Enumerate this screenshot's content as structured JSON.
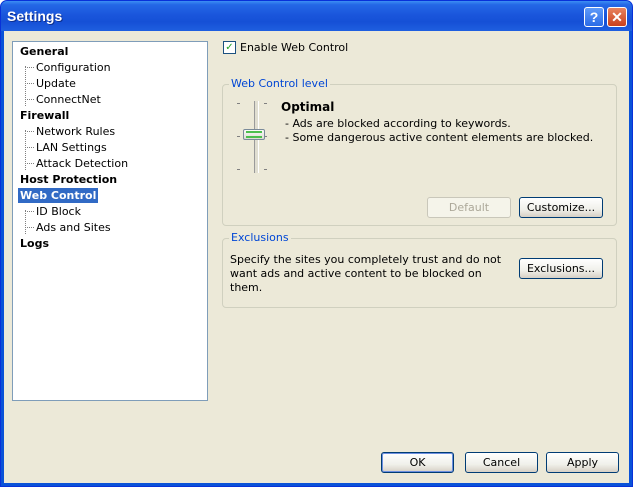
{
  "window": {
    "title": "Settings",
    "help_glyph": "?",
    "close_glyph": "✕"
  },
  "tree": {
    "general": {
      "label": "General",
      "children": [
        "Configuration",
        "Update",
        "ConnectNet"
      ]
    },
    "firewall": {
      "label": "Firewall",
      "children": [
        "Network Rules",
        "LAN Settings",
        "Attack Detection"
      ]
    },
    "host_protection": {
      "label": "Host Protection"
    },
    "web_control": {
      "label": "Web Control",
      "children": [
        "ID Block",
        "Ads and Sites"
      ]
    },
    "logs": {
      "label": "Logs"
    }
  },
  "enable": {
    "label": "Enable Web Control",
    "checked": true,
    "check_glyph": "✓"
  },
  "level_group": {
    "legend": "Web Control level",
    "level_name": "Optimal",
    "desc": [
      "- Ads are blocked according to keywords.",
      "- Some dangerous active content elements are blocked."
    ],
    "default_button": "Default",
    "customize_button": "Customize..."
  },
  "exclusions_group": {
    "legend": "Exclusions",
    "text": "Specify the sites you completely trust and do not want ads and active content to be blocked on them.",
    "button": "Exclusions..."
  },
  "footer": {
    "ok": "OK",
    "cancel": "Cancel",
    "apply": "Apply"
  }
}
